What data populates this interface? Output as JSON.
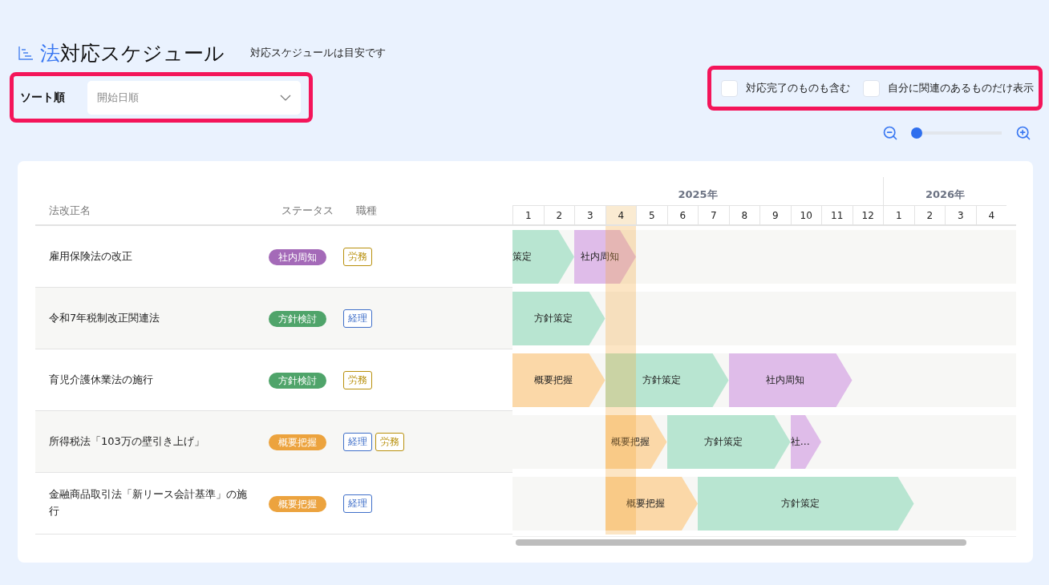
{
  "header": {
    "title_accent": "法",
    "title": "対応スケジュール",
    "note": "対応スケジュールは目安です"
  },
  "sort": {
    "label": "ソート順",
    "value": "開始日順"
  },
  "filters": [
    {
      "label": "対応完了のものも含む",
      "checked": false
    },
    {
      "label": "自分に関連のあるものだけ表示",
      "checked": false
    }
  ],
  "zoom": {
    "level": 0.05
  },
  "table": {
    "columns": [
      "法改正名",
      "ステータス",
      "職種"
    ],
    "rows": [
      {
        "name": "雇用保険法の改正",
        "status": {
          "label": "社内周知",
          "kind": "notice"
        },
        "roles": [
          {
            "label": "労務",
            "kind": "labor"
          }
        ],
        "bars": [
          {
            "label": "策定",
            "kind": "policy"
          },
          {
            "label": "社内周知",
            "kind": "notice"
          }
        ]
      },
      {
        "name": "令和7年税制改正関連法",
        "status": {
          "label": "方針検討",
          "kind": "policy"
        },
        "roles": [
          {
            "label": "経理",
            "kind": "accounting"
          }
        ],
        "bars": [
          {
            "label": "方針策定",
            "kind": "policy"
          }
        ]
      },
      {
        "name": "育児介護休業法の施行",
        "status": {
          "label": "方針検討",
          "kind": "policy"
        },
        "roles": [
          {
            "label": "労務",
            "kind": "labor"
          }
        ],
        "bars": [
          {
            "label": "概要把握",
            "kind": "overview"
          },
          {
            "label": "方針策定",
            "kind": "policy"
          },
          {
            "label": "社内周知",
            "kind": "notice"
          }
        ]
      },
      {
        "name": "所得税法「103万の壁引き上げ」",
        "status": {
          "label": "概要把握",
          "kind": "overview"
        },
        "roles": [
          {
            "label": "経理",
            "kind": "accounting"
          },
          {
            "label": "労務",
            "kind": "labor"
          }
        ],
        "bars": [
          {
            "label": "概要把握",
            "kind": "overview"
          },
          {
            "label": "方針策定",
            "kind": "policy"
          },
          {
            "label": "社…",
            "kind": "notice"
          }
        ]
      },
      {
        "name": "金融商品取引法「新リース会計基準」の施行",
        "status": {
          "label": "概要把握",
          "kind": "overview"
        },
        "roles": [
          {
            "label": "経理",
            "kind": "accounting"
          }
        ],
        "bars": [
          {
            "label": "概要把握",
            "kind": "overview"
          },
          {
            "label": "方針策定",
            "kind": "policy"
          }
        ]
      }
    ]
  },
  "timeline": {
    "years": [
      {
        "label": "2025年"
      },
      {
        "label": "2026年"
      }
    ],
    "months": [
      {
        "label": "1",
        "selected": false
      },
      {
        "label": "2",
        "selected": false
      },
      {
        "label": "3",
        "selected": false
      },
      {
        "label": "4",
        "selected": true
      },
      {
        "label": "5",
        "selected": false
      },
      {
        "label": "6",
        "selected": false
      },
      {
        "label": "7",
        "selected": false
      },
      {
        "label": "8",
        "selected": false
      },
      {
        "label": "9",
        "selected": false
      },
      {
        "label": "10",
        "selected": false
      },
      {
        "label": "11",
        "selected": false
      },
      {
        "label": "12",
        "selected": false
      },
      {
        "label": "1",
        "selected": false
      },
      {
        "label": "2",
        "selected": false
      },
      {
        "label": "3",
        "selected": false
      },
      {
        "label": "4",
        "selected": false
      }
    ]
  }
}
